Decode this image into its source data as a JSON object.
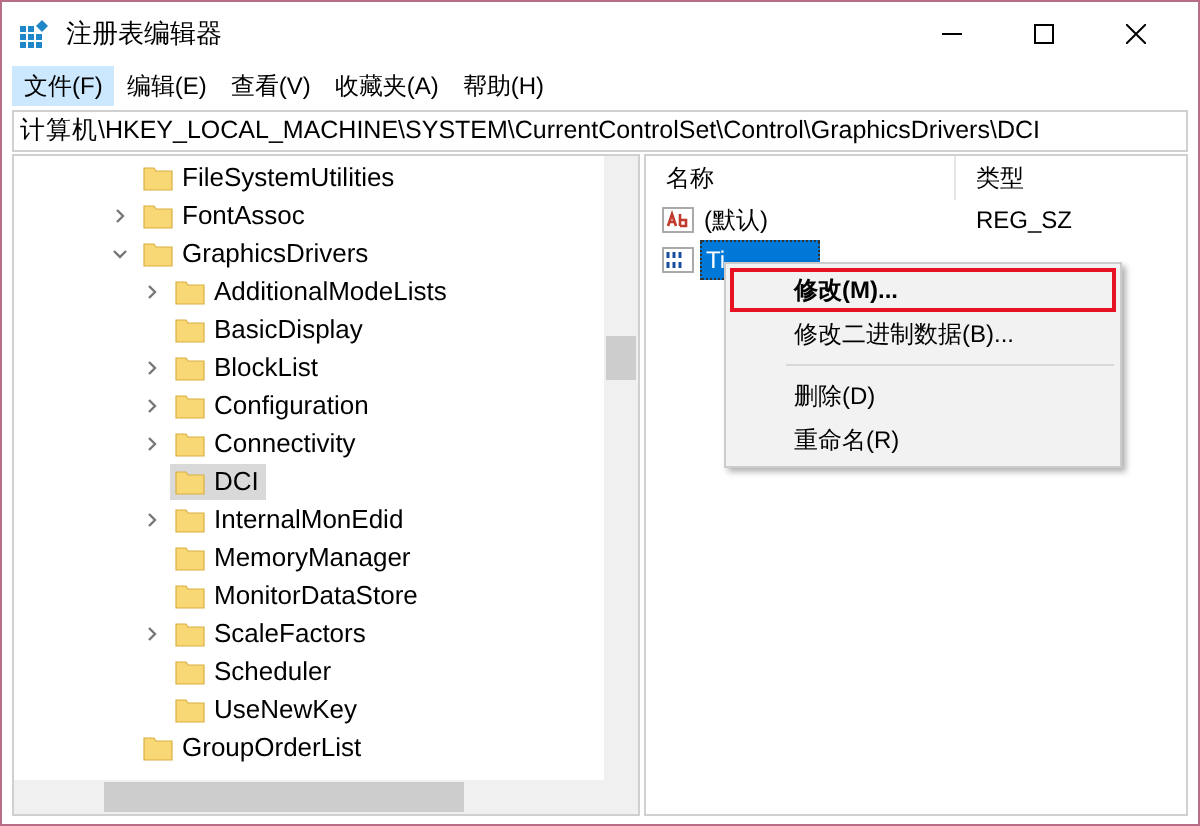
{
  "window": {
    "title": "注册表编辑器"
  },
  "menu": [
    {
      "label": "文件(F)",
      "selected": true
    },
    {
      "label": "编辑(E)",
      "selected": false
    },
    {
      "label": "查看(V)",
      "selected": false
    },
    {
      "label": "收藏夹(A)",
      "selected": false
    },
    {
      "label": "帮助(H)",
      "selected": false
    }
  ],
  "address": "计算机\\HKEY_LOCAL_MACHINE\\SYSTEM\\CurrentControlSet\\Control\\GraphicsDrivers\\DCI",
  "tree": [
    {
      "label": "FileSystemUtilities",
      "kind": "leaf",
      "selected": false
    },
    {
      "label": "FontAssoc",
      "kind": "collapsed",
      "selected": false
    },
    {
      "label": "GraphicsDrivers",
      "kind": "expanded",
      "selected": false,
      "children": [
        {
          "label": "AdditionalModeLists",
          "kind": "collapsed",
          "selected": false
        },
        {
          "label": "BasicDisplay",
          "kind": "leaf",
          "selected": false
        },
        {
          "label": "BlockList",
          "kind": "collapsed",
          "selected": false
        },
        {
          "label": "Configuration",
          "kind": "collapsed",
          "selected": false
        },
        {
          "label": "Connectivity",
          "kind": "collapsed",
          "selected": false
        },
        {
          "label": "DCI",
          "kind": "leaf",
          "selected": true
        },
        {
          "label": "InternalMonEdid",
          "kind": "collapsed",
          "selected": false
        },
        {
          "label": "MemoryManager",
          "kind": "leaf",
          "selected": false
        },
        {
          "label": "MonitorDataStore",
          "kind": "leaf",
          "selected": false
        },
        {
          "label": "ScaleFactors",
          "kind": "collapsed",
          "selected": false
        },
        {
          "label": "Scheduler",
          "kind": "leaf",
          "selected": false
        },
        {
          "label": "UseNewKey",
          "kind": "leaf",
          "selected": false
        }
      ]
    },
    {
      "label": "GroupOrderList",
      "kind": "leaf",
      "selected": false
    }
  ],
  "values": {
    "columns": [
      "名称",
      "类型"
    ],
    "rows": [
      {
        "kind": "string",
        "name": "(默认)",
        "type": "REG_SZ",
        "selected": false
      },
      {
        "kind": "binary",
        "name": "Ti",
        "selected": true
      }
    ]
  },
  "context_menu": [
    {
      "kind": "item",
      "label": "修改(M)...",
      "selected": true,
      "bold": true
    },
    {
      "kind": "item",
      "label": "修改二进制数据(B)...",
      "selected": false,
      "bold": false
    },
    {
      "kind": "separator"
    },
    {
      "kind": "item",
      "label": "删除(D)",
      "selected": false,
      "bold": false
    },
    {
      "kind": "item",
      "label": "重命名(R)",
      "selected": false,
      "bold": false
    }
  ]
}
